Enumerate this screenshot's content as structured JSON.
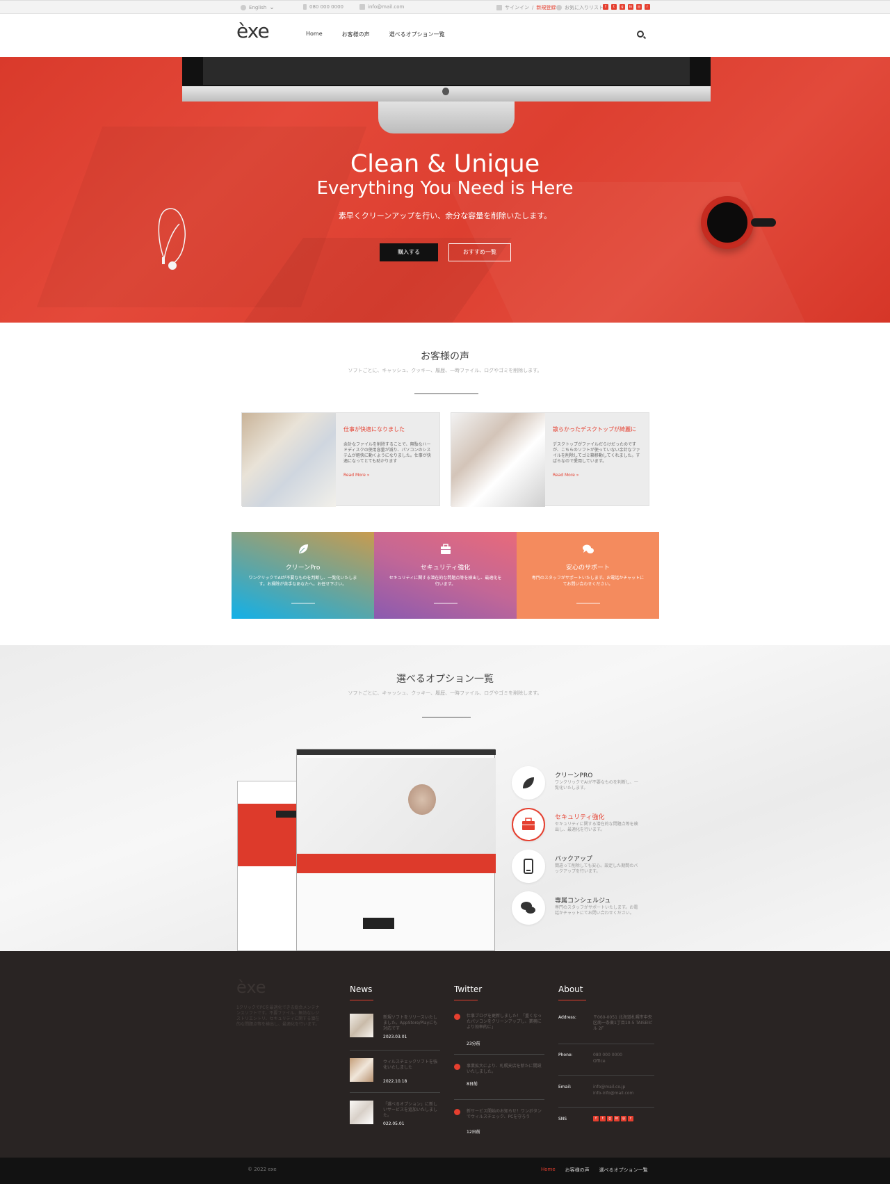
{
  "topbar": {
    "language": "English",
    "phone": "080 000 0000",
    "email": "info@mail.com",
    "signin": "サインイン",
    "register": "新規登録",
    "wishlist": "お気に入りリスト"
  },
  "header": {
    "logo": "èxe",
    "nav": [
      "Home",
      "お客様の声",
      "選べるオプション一覧"
    ]
  },
  "hero": {
    "title": "Clean & Unique",
    "subtitle": "Everything You Need is Here",
    "lead": "素早くクリーンアップを行い、余分な容量を削除いたします。",
    "buy_label": "購入する",
    "recommend_label": "おすすめ一覧"
  },
  "testimonials": {
    "title": "お客様の声",
    "subtitle": "ソフトごとに、キャッシュ、クッキー、履歴、一時ファイル、ログやゴミを削除します。",
    "items": [
      {
        "title": "仕事が快適になりました",
        "body": "余計なファイルを削除することで、無駄なハードディスクの使用容量が減り、パソコンのシステムが軽快に動くようになりました。仕事が快適になってとても助かります",
        "more": "Read More »"
      },
      {
        "title": "散らかったデスクトップが綺麗に",
        "body": "デスクトップがファイルだらけだったのですが、こちらのソフトが使っていない余計なファイルを削除してゴミ箱移動してくれました。すばらなので愛用しています。",
        "more": "Read More »"
      }
    ]
  },
  "features": [
    {
      "icon": "leaf-icon",
      "title": "クリーンPro",
      "desc": "ワンクリックでAIが不要なものを判断し、一覧化いたします。お掃除が苦手なあなたへ。お任せ下さい。"
    },
    {
      "icon": "briefcase-icon",
      "title": "セキュリティ強化",
      "desc": "セキュリティに関する潜在的な問題点等を検出し、最適化を行います。"
    },
    {
      "icon": "chat-icon",
      "title": "安心のサポート",
      "desc": "専門のスタッフがサポートいたします。お電話かチャットにてお問い合わせください。"
    }
  ],
  "options": {
    "title": "選べるオプション一覧",
    "subtitle": "ソフトごとに、キャッシュ、クッキー、履歴、一時ファイル、ログやゴミを削除します。",
    "items": [
      {
        "icon": "leaf-icon",
        "title": "クリーンPRO",
        "desc": "ワンクリックでAIが不要なものを判断し、一覧化いたします。",
        "active": false
      },
      {
        "icon": "briefcase-icon",
        "title": "セキュリティ強化",
        "desc": "セキュリティに関する潜在的な問題点等を検出し、最適化を行います。",
        "active": true
      },
      {
        "icon": "phone-icon",
        "title": "バックアップ",
        "desc": "間違って削除しても安心。設定した期間のバックアップを行います。",
        "active": false
      },
      {
        "icon": "chat-icon",
        "title": "専属コンシェルジュ",
        "desc": "専門のスタッフがサポートいたします。お電話かチャットにてお問い合わせください。",
        "active": false
      }
    ]
  },
  "footer": {
    "logo": "èxe",
    "about_text": "1クリックでPCを最適化できる総合メンテナンスソフトです。不要ファイル、無効なレジストリエントリ、セキュリティに関する潜在的な問題点等を検出し、最適化を行います。",
    "news_title": "News",
    "news": [
      {
        "text": "新規ソフトをリリースいたしました。AppStore/Playにも対応です",
        "date": "2023.03.01"
      },
      {
        "text": "ウィルスチェックソフトを強化いたしました",
        "date": "2022.10.18"
      },
      {
        "text": "「選べるオプション」に新しいサービスを追加いたしました。",
        "date": "022.05.01"
      }
    ],
    "twitter_title": "Twitter",
    "tweets": [
      {
        "text": "仕事ブログを更新しました！「重くなったパソコンをクリーンアップし、業務により効率的に」",
        "time": "23分前"
      },
      {
        "text": "事業拡大により、札幌支店を新たに開設いたしました。",
        "time": "8日前"
      },
      {
        "text": "新サービス開始のお知らせ！ワンボタンでウィルスチェック、PCを守ろう",
        "time": "12日前"
      }
    ],
    "about_title": "About",
    "address_label": "Address:",
    "address": "〒060-0051 北海道札幌市中央区南一条東1丁目10-5 TAISEIビル 2F",
    "phone_label": "Phone:",
    "phone": "080 000 0000",
    "phone_sub": "Office",
    "email_label": "Email:",
    "email1": "info@mail.co.jp",
    "email2": "info-info@mail.com",
    "sns_label": "SNS"
  },
  "bottom": {
    "copyright": "© 2022 exe",
    "nav": [
      "Home",
      "お客様の声",
      "選べるオプション一覧"
    ]
  },
  "colors": {
    "accent": "#e53f2f",
    "footer_bg": "#292423",
    "hero_bg": "#df4133"
  }
}
